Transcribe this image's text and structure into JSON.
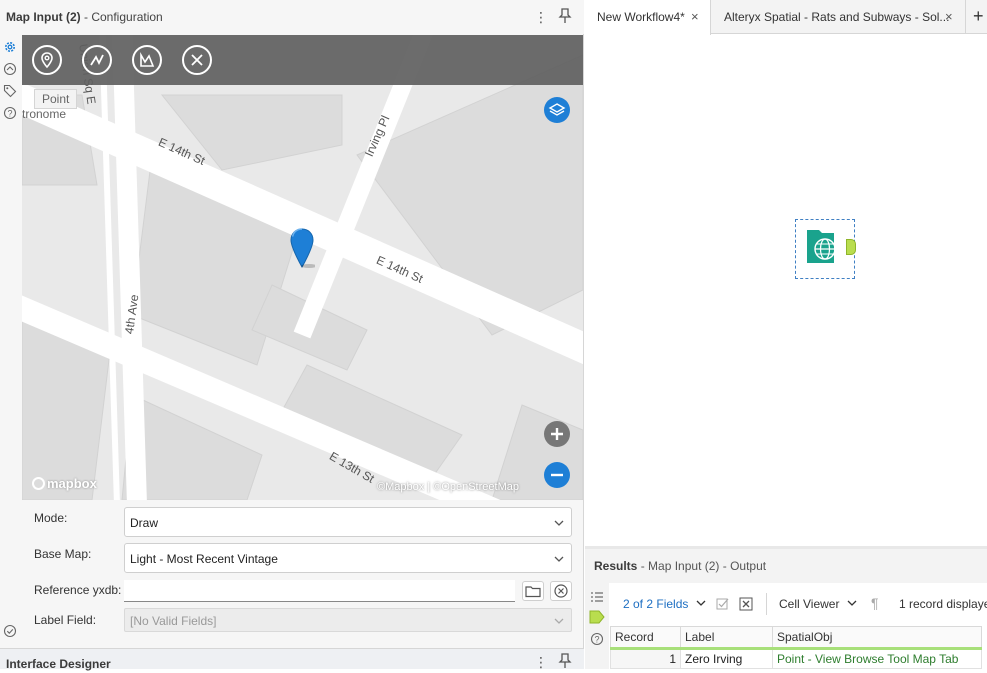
{
  "config_panel": {
    "title": "Map Input (2)",
    "subtitle": "- Configuration",
    "menu_glyph": "⋮",
    "pin_glyph": "⊥"
  },
  "map": {
    "tooltip": "Point",
    "tooltip_fragment": "tronome",
    "streets": [
      "Union Sq E",
      "E 14th St",
      "Irving Pl",
      "E 14th St",
      "4th Ave",
      "E 13th St"
    ],
    "attribution": "©Mapbox | ©OpenStreetMap",
    "logo": "mapbox",
    "draw_tools": [
      "point-tool-icon",
      "line-tool-icon",
      "polygon-tool-icon",
      "delete-tool-icon"
    ],
    "layers_button_color": "#1e7fd6",
    "zoom_out_color": "#1e7fd6",
    "zoom_in_color": "#777777",
    "marker_color": "#1e7fd6"
  },
  "form": {
    "mode_label": "Mode:",
    "mode_value": "Draw",
    "basemap_label": "Base Map:",
    "basemap_value": "Light - Most Recent Vintage",
    "reference_label": "Reference yxdb:",
    "reference_value": "",
    "labelfield_label": "Label Field:",
    "labelfield_placeholder": "[No Valid Fields]"
  },
  "interface_designer": {
    "title": "Interface Designer"
  },
  "workflow_tabs": [
    {
      "label": "New Workflow4*",
      "active": true
    },
    {
      "label": "Alteryx Spatial - Rats and Subways - Sol..."
    }
  ],
  "add_tab_glyph": "+",
  "canvas": {
    "tool_color": "#1aa38d",
    "output_anchor_color": "#b9dd4e"
  },
  "results": {
    "title": "Results",
    "subtitle": "- Map Input (2) - Output",
    "fields_selector": "2 of 2 Fields",
    "cell_viewer": "Cell Viewer",
    "record_count": "1 record displaye",
    "columns": [
      "Record",
      "Label",
      "SpatialObj"
    ],
    "rows": [
      {
        "record": "1",
        "label": "Zero Irving",
        "spatial": "Point - View Browse Tool Map Tab"
      }
    ]
  }
}
